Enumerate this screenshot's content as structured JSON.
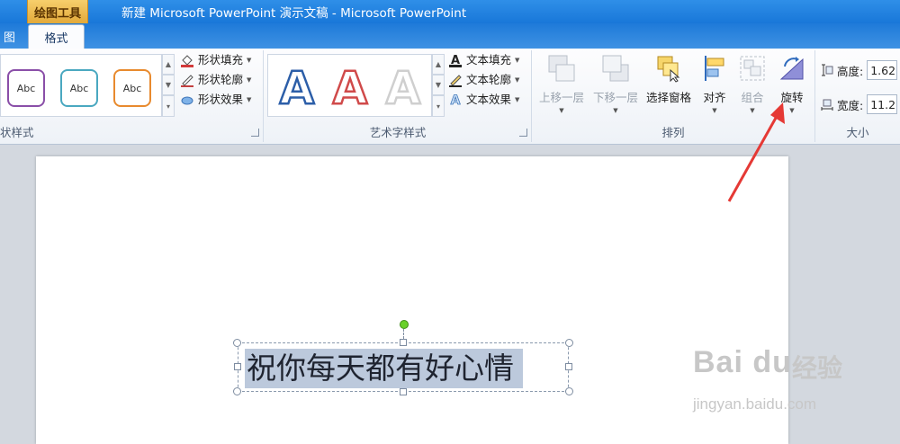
{
  "window": {
    "title": "新建 Microsoft PowerPoint 演示文稿 - Microsoft PowerPoint",
    "contextual_tab_group": "绘图工具"
  },
  "tabs": {
    "partial_left": "图",
    "active": "格式"
  },
  "ribbon": {
    "shape_styles": {
      "group_label": "状样式",
      "thumbnails": [
        {
          "text": "Abc",
          "color": "#8a4fa8"
        },
        {
          "text": "Abc",
          "color": "#4aa8c0"
        },
        {
          "text": "Abc",
          "color": "#e88a2e"
        }
      ],
      "fill": "形状填充",
      "outline": "形状轮廓",
      "effects": "形状效果"
    },
    "wordart_styles": {
      "group_label": "艺术字样式",
      "samples": [
        {
          "letter": "A",
          "color": "#2c5ea8"
        },
        {
          "letter": "A",
          "color": "#d04a4a"
        },
        {
          "letter": "A",
          "color": "#d9d9d9"
        }
      ],
      "text_fill": "文本填充",
      "text_outline": "文本轮廓",
      "text_effects": "文本效果"
    },
    "arrange": {
      "group_label": "排列",
      "bring_forward": "上移一层",
      "send_backward": "下移一层",
      "selection_pane": "选择窗格",
      "align": "对齐",
      "group": "组合",
      "rotate": "旋转"
    },
    "size": {
      "group_label": "大小",
      "height_label": "高度:",
      "height_value": "1.62",
      "width_label": "宽度:",
      "width_value": "11.2"
    }
  },
  "slide": {
    "textbox_text": "祝你每天都有好心情"
  },
  "watermark": {
    "brand": "Bai du",
    "cn": "经验",
    "url": "jingyan.baidu.com"
  },
  "colors": {
    "titlebar": "#1f7ad8",
    "contextual_tab": "#f0be55",
    "annotation_arrow": "#e53935",
    "selection_highlight": "#bcc9dc"
  }
}
